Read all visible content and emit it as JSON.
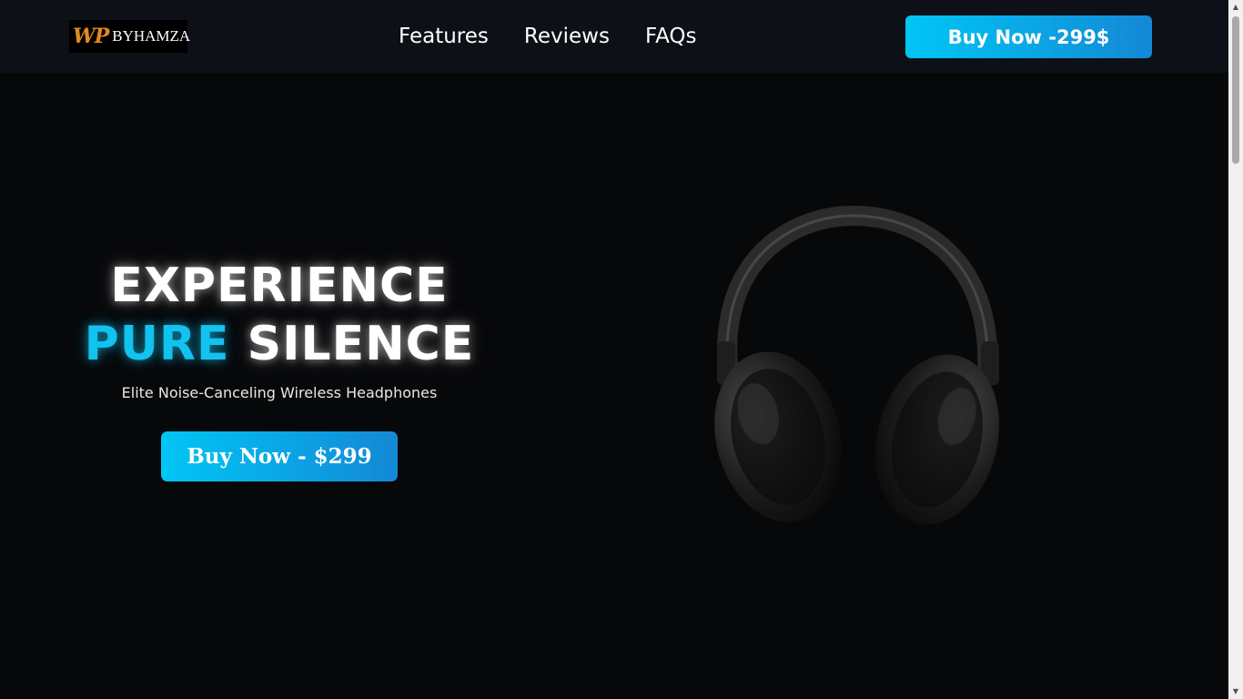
{
  "header": {
    "logo_wp": "WP",
    "logo_text": "BYHAMZA",
    "nav": [
      "Features",
      "Reviews",
      "FAQs"
    ],
    "cta_label": "Buy Now -299$"
  },
  "hero": {
    "line1": "EXPERIENCE",
    "line2_accent": "PURE",
    "line2_rest": "SILENCE",
    "subtitle": "Elite Noise-Canceling Wireless Headphones",
    "cta_label": "Buy Now - $299"
  },
  "colors": {
    "accent": "#12c2ef",
    "button_gradient_start": "#00c6f5",
    "button_gradient_end": "#1488d6",
    "background": "#07080a",
    "header_bg": "#0d1117",
    "logo_orange": "#e08a1e"
  },
  "icons": {
    "scroll_up": "▲",
    "scroll_down": "▼"
  }
}
